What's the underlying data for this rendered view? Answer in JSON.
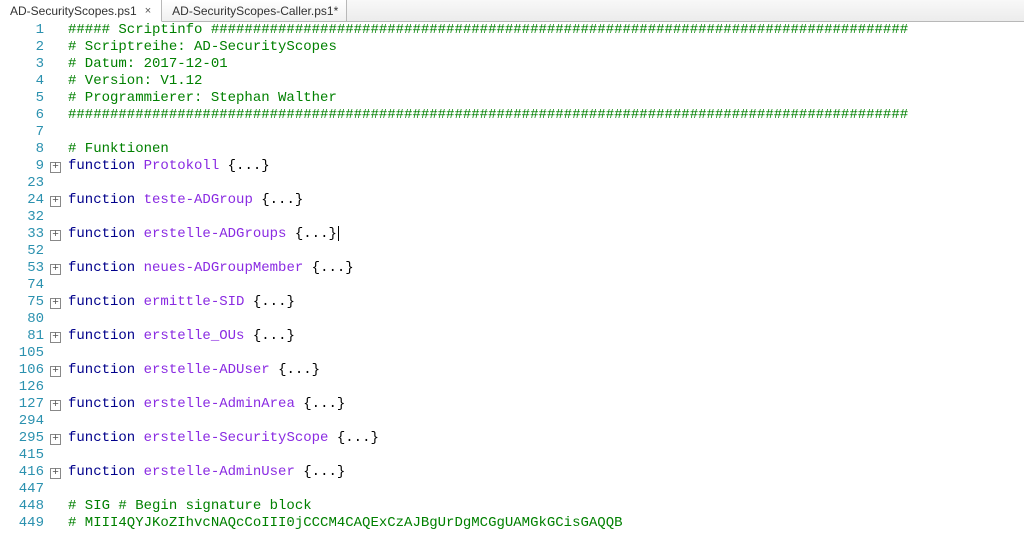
{
  "tabs": [
    {
      "label": "AD-SecurityScopes.ps1",
      "active": true,
      "dirty": false
    },
    {
      "label": "AD-SecurityScopes-Caller.ps1",
      "active": false,
      "dirty": true
    }
  ],
  "close_glyph": "×",
  "fold_glyph": "+",
  "lines": [
    {
      "n": 1,
      "fold": false,
      "tokens": [
        [
          "comment",
          "##### Scriptinfo ###################################################################################"
        ]
      ]
    },
    {
      "n": 2,
      "fold": false,
      "tokens": [
        [
          "comment",
          "# Scriptreihe:     AD-SecurityScopes"
        ]
      ]
    },
    {
      "n": 3,
      "fold": false,
      "tokens": [
        [
          "comment",
          "# Datum:           2017-12-01"
        ]
      ]
    },
    {
      "n": 4,
      "fold": false,
      "tokens": [
        [
          "comment",
          "# Version:         V1.12"
        ]
      ]
    },
    {
      "n": 5,
      "fold": false,
      "tokens": [
        [
          "comment",
          "# Programmierer:   Stephan Walther"
        ]
      ]
    },
    {
      "n": 6,
      "fold": false,
      "tokens": [
        [
          "comment",
          "####################################################################################################"
        ]
      ]
    },
    {
      "n": 7,
      "fold": false,
      "tokens": []
    },
    {
      "n": 8,
      "fold": false,
      "tokens": [
        [
          "comment",
          "# Funktionen"
        ]
      ]
    },
    {
      "n": 9,
      "fold": true,
      "tokens": [
        [
          "text",
          "  "
        ],
        [
          "keyword",
          "function"
        ],
        [
          "text",
          " "
        ],
        [
          "func",
          "Protokoll"
        ],
        [
          "text",
          " "
        ],
        [
          "punct",
          "{...}"
        ]
      ]
    },
    {
      "n": 23,
      "fold": false,
      "tokens": []
    },
    {
      "n": 24,
      "fold": true,
      "tokens": [
        [
          "text",
          "  "
        ],
        [
          "keyword",
          "function"
        ],
        [
          "text",
          " "
        ],
        [
          "func",
          "teste-ADGroup"
        ],
        [
          "text",
          " "
        ],
        [
          "punct",
          "{...}"
        ]
      ]
    },
    {
      "n": 32,
      "fold": false,
      "tokens": []
    },
    {
      "n": 33,
      "fold": true,
      "cursor": true,
      "tokens": [
        [
          "text",
          "  "
        ],
        [
          "keyword",
          "function"
        ],
        [
          "text",
          " "
        ],
        [
          "func",
          "erstelle-ADGroups"
        ],
        [
          "text",
          " "
        ],
        [
          "punct",
          "{...}"
        ]
      ]
    },
    {
      "n": 52,
      "fold": false,
      "tokens": []
    },
    {
      "n": 53,
      "fold": true,
      "tokens": [
        [
          "text",
          "  "
        ],
        [
          "keyword",
          "function"
        ],
        [
          "text",
          " "
        ],
        [
          "func",
          "neues-ADGroupMember"
        ],
        [
          "text",
          " "
        ],
        [
          "punct",
          "{...}"
        ]
      ]
    },
    {
      "n": 74,
      "fold": false,
      "tokens": []
    },
    {
      "n": 75,
      "fold": true,
      "tokens": [
        [
          "text",
          "  "
        ],
        [
          "keyword",
          "function"
        ],
        [
          "text",
          " "
        ],
        [
          "func",
          "ermittle-SID"
        ],
        [
          "text",
          " "
        ],
        [
          "punct",
          "{...}"
        ]
      ]
    },
    {
      "n": 80,
      "fold": false,
      "tokens": []
    },
    {
      "n": 81,
      "fold": true,
      "tokens": [
        [
          "text",
          "  "
        ],
        [
          "keyword",
          "function"
        ],
        [
          "text",
          " "
        ],
        [
          "func",
          "erstelle_OUs"
        ],
        [
          "text",
          " "
        ],
        [
          "punct",
          "{...}"
        ]
      ]
    },
    {
      "n": 105,
      "fold": false,
      "tokens": []
    },
    {
      "n": 106,
      "fold": true,
      "tokens": [
        [
          "text",
          "  "
        ],
        [
          "keyword",
          "function"
        ],
        [
          "text",
          " "
        ],
        [
          "func",
          "erstelle-ADUser"
        ],
        [
          "text",
          " "
        ],
        [
          "punct",
          "{...}"
        ]
      ]
    },
    {
      "n": 126,
      "fold": false,
      "tokens": []
    },
    {
      "n": 127,
      "fold": true,
      "tokens": [
        [
          "text",
          "  "
        ],
        [
          "keyword",
          "function"
        ],
        [
          "text",
          " "
        ],
        [
          "func",
          "erstelle-AdminArea"
        ],
        [
          "text",
          " "
        ],
        [
          "punct",
          "{...}"
        ]
      ]
    },
    {
      "n": 294,
      "fold": false,
      "tokens": []
    },
    {
      "n": 295,
      "fold": true,
      "tokens": [
        [
          "text",
          "  "
        ],
        [
          "keyword",
          "function"
        ],
        [
          "text",
          " "
        ],
        [
          "func",
          "erstelle-SecurityScope"
        ],
        [
          "text",
          " "
        ],
        [
          "punct",
          "{...}"
        ]
      ]
    },
    {
      "n": 415,
      "fold": false,
      "tokens": []
    },
    {
      "n": 416,
      "fold": true,
      "tokens": [
        [
          "text",
          "  "
        ],
        [
          "keyword",
          "function"
        ],
        [
          "text",
          " "
        ],
        [
          "func",
          "erstelle-AdminUser"
        ],
        [
          "text",
          " "
        ],
        [
          "punct",
          "{...}"
        ]
      ]
    },
    {
      "n": 447,
      "fold": false,
      "tokens": []
    },
    {
      "n": 448,
      "fold": false,
      "tokens": [
        [
          "comment",
          "# SIG # Begin signature block"
        ]
      ]
    },
    {
      "n": 449,
      "fold": false,
      "tokens": [
        [
          "comment",
          "# MIII4QYJKoZIhvcNAQcCoIII0jCCCM4CAQExCzAJBgUrDgMCGgUAMGkGCisGAQQB"
        ]
      ]
    }
  ]
}
